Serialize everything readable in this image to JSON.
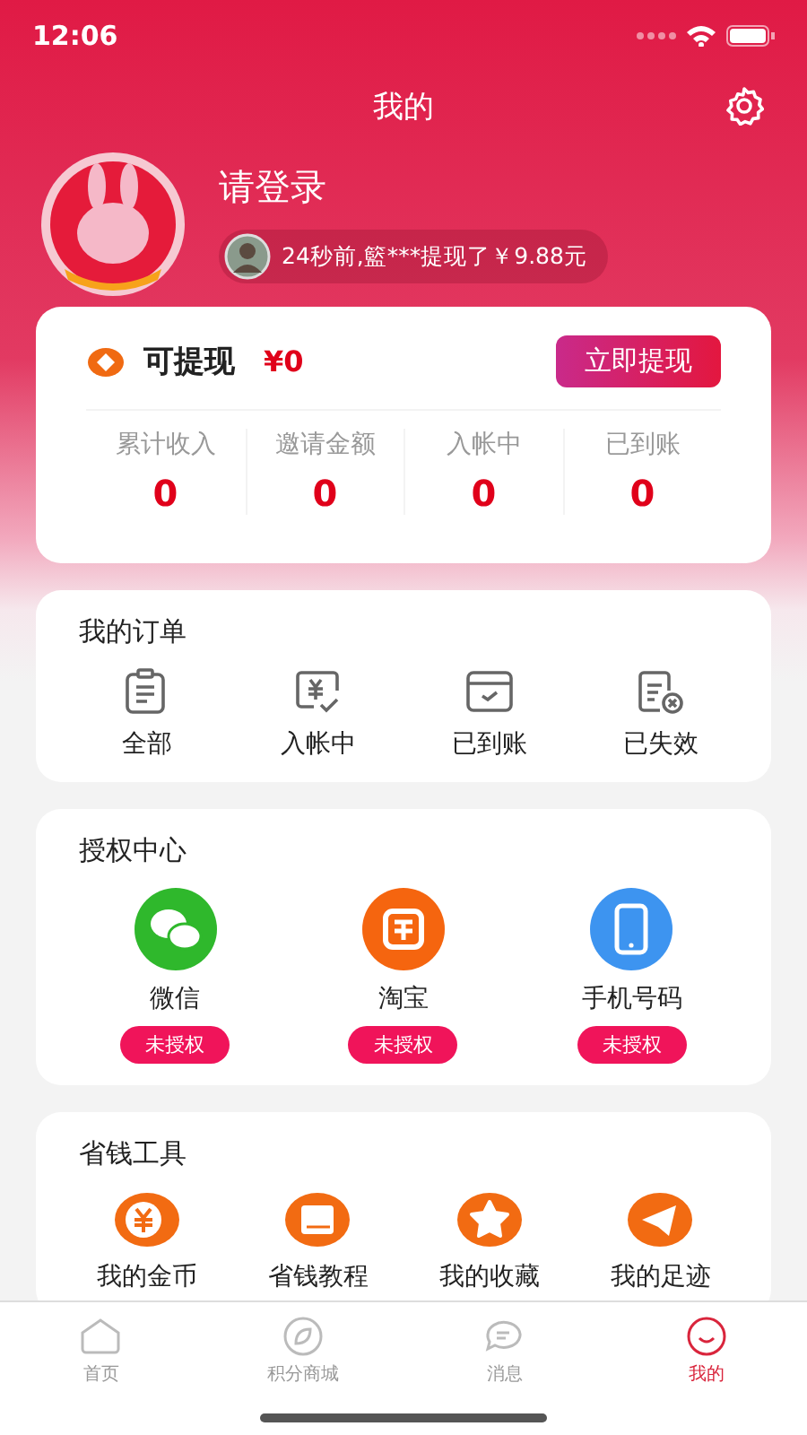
{
  "status_bar": {
    "time": "12:06"
  },
  "header": {
    "title": "我的"
  },
  "profile": {
    "name": "请登录",
    "ticker": "24秒前,籃***提现了￥9.88元"
  },
  "wallet": {
    "label": "可提现",
    "amount": "¥0",
    "button": "立即提现",
    "stats": [
      {
        "label": "累计收入",
        "value": "0"
      },
      {
        "label": "邀请金额",
        "value": "0"
      },
      {
        "label": "入帐中",
        "value": "0"
      },
      {
        "label": "已到账",
        "value": "0"
      }
    ]
  },
  "orders": {
    "title": "我的订单",
    "items": [
      {
        "label": "全部"
      },
      {
        "label": "入帐中"
      },
      {
        "label": "已到账"
      },
      {
        "label": "已失效"
      }
    ]
  },
  "auth": {
    "title": "授权中心",
    "items": [
      {
        "label": "微信",
        "status": "未授权"
      },
      {
        "label": "淘宝",
        "status": "未授权"
      },
      {
        "label": "手机号码",
        "status": "未授权"
      }
    ]
  },
  "tools": {
    "title": "省钱工具",
    "items": [
      {
        "label": "我的金币"
      },
      {
        "label": "省钱教程"
      },
      {
        "label": "我的收藏"
      },
      {
        "label": "我的足迹"
      }
    ]
  },
  "tab_bar": [
    {
      "label": "首页",
      "selected": false
    },
    {
      "label": "积分商城",
      "selected": false
    },
    {
      "label": "消息",
      "selected": false
    },
    {
      "label": "我的",
      "selected": true
    }
  ]
}
